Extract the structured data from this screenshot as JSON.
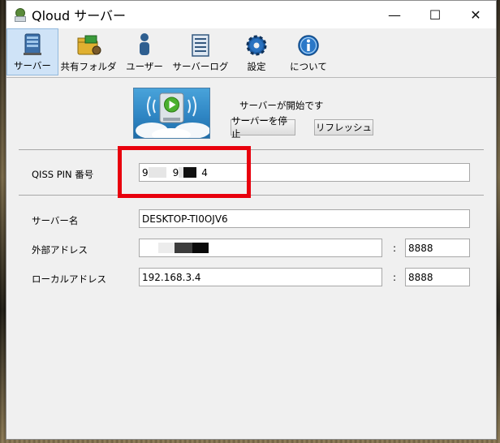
{
  "window": {
    "title": "Qloud サーバー",
    "controls": [
      "—",
      "☐",
      "✕"
    ]
  },
  "toolbar": {
    "items": [
      {
        "label": "サーバー",
        "icon": "server-icon",
        "active": true
      },
      {
        "label": "共有フォルダ",
        "icon": "shared-folder-icon",
        "active": false
      },
      {
        "label": "ユーザー",
        "icon": "user-icon",
        "active": false
      },
      {
        "label": "サーバーログ",
        "icon": "log-icon",
        "active": false
      },
      {
        "label": "設定",
        "icon": "gear-icon",
        "active": false
      },
      {
        "label": "について",
        "icon": "info-icon",
        "active": false
      }
    ]
  },
  "server": {
    "status": "サーバーが開始です",
    "stop_button": "サーバーを停止",
    "refresh_button": "リフレッシュ"
  },
  "pin": {
    "label": "QISS PIN 番号",
    "value_parts": [
      "9",
      "9",
      "4"
    ]
  },
  "fields": {
    "server_name_label": "サーバー名",
    "server_name_value": "DESKTOP-TI0OJV6",
    "external_label": "外部アドレス",
    "external_value": "",
    "external_port": "8888",
    "local_label": "ローカルアドレス",
    "local_value": "192.168.3.4",
    "local_port": "8888",
    "colon": ":"
  },
  "colors": {
    "highlight": "#e8000d",
    "active_tab_bg": "#cfe3f7"
  }
}
